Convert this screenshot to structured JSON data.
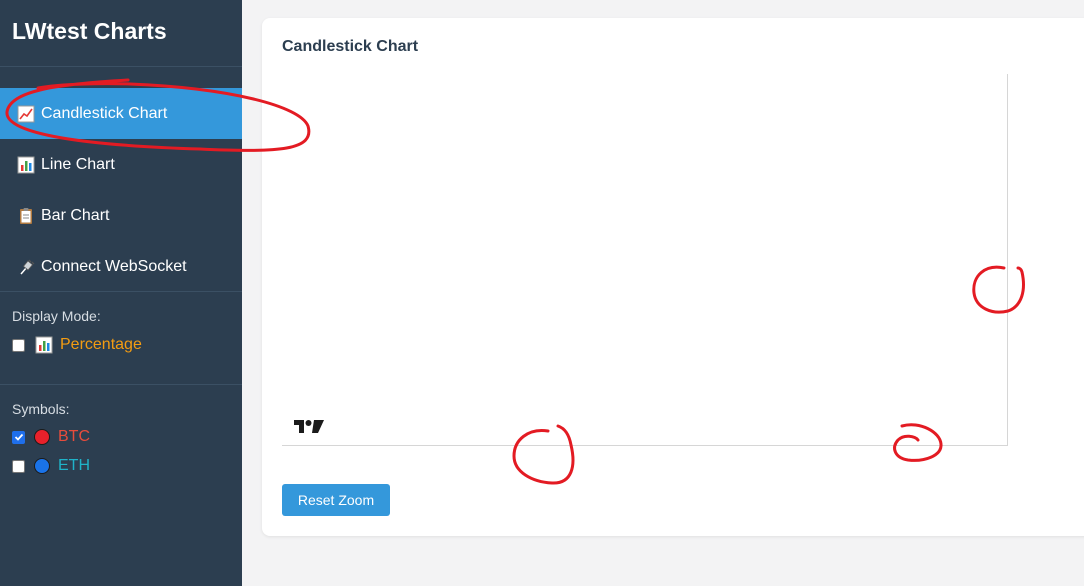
{
  "sidebar": {
    "title": "LWtest Charts",
    "nav": [
      {
        "icon": "line-chart-icon",
        "label": "Candlestick Chart",
        "active": true
      },
      {
        "icon": "bar-chart-icon",
        "label": "Line Chart",
        "active": false
      },
      {
        "icon": "clipboard-icon",
        "label": "Bar Chart",
        "active": false
      },
      {
        "icon": "plug-icon",
        "label": "Connect WebSocket",
        "active": false
      }
    ],
    "display_mode": {
      "label": "Display Mode:",
      "option_label": "Percentage",
      "option_checked": false,
      "option_color": "#f39c12"
    },
    "symbols": {
      "label": "Symbols:",
      "items": [
        {
          "name": "BTC",
          "checked": true,
          "dot_color": "#e8212b",
          "text_color": "#e74c3c"
        },
        {
          "name": "ETH",
          "checked": false,
          "dot_color": "#1a73e8",
          "text_color": "#1fb3c9"
        }
      ]
    }
  },
  "main": {
    "title": "Candlestick Chart",
    "reset_label": "Reset Zoom"
  },
  "colors": {
    "sidebar_bg": "#2c3e50",
    "accent": "#3498db",
    "annotation": "#e31b23"
  }
}
